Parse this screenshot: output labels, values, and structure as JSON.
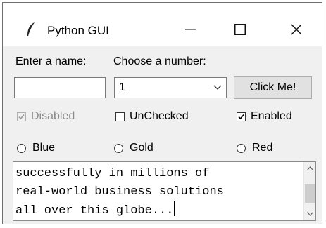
{
  "window": {
    "title": "Python GUI",
    "app_icon": "feather-icon",
    "controls": {
      "minimize": "minimize-icon",
      "maximize": "maximize-icon",
      "close": "close-icon"
    }
  },
  "labels": {
    "name_label": "Enter a name:",
    "number_label": "Choose a number:"
  },
  "entry": {
    "value": ""
  },
  "combobox": {
    "selected": "1",
    "icon": "chevron-down-icon"
  },
  "button": {
    "label": "Click Me!"
  },
  "checkboxes": [
    {
      "label": "Disabled",
      "checked": true,
      "enabled": false
    },
    {
      "label": "UnChecked",
      "checked": false,
      "enabled": true
    },
    {
      "label": "Enabled",
      "checked": true,
      "enabled": true
    }
  ],
  "radios": [
    {
      "label": "Blue",
      "selected": false
    },
    {
      "label": "Gold",
      "selected": false
    },
    {
      "label": "Red",
      "selected": false
    }
  ],
  "scrolled_text": {
    "lines": [
      "successfully in millions of",
      "real-world business solutions",
      "all over this globe..."
    ]
  },
  "colors": {
    "window_bg": "#f0f0f0",
    "disabled_text": "#8a8a8a"
  }
}
